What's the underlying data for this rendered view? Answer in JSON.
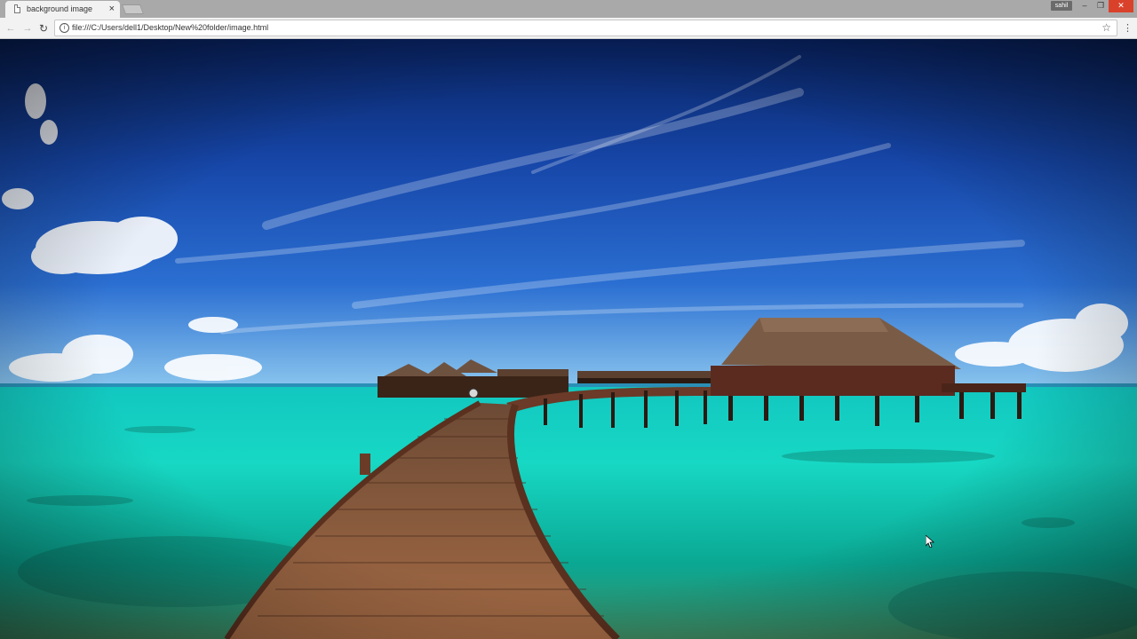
{
  "tab": {
    "title": "background image",
    "close": "×",
    "icon": "document-icon"
  },
  "window": {
    "user_badge": "sahil",
    "minimize": "–",
    "restore": "❐",
    "close": "✕"
  },
  "toolbar": {
    "back": "←",
    "forward": "→",
    "reload": "↻",
    "url": "file:///C:/Users/dell1/Desktop/New%20folder/image.html",
    "info": "i",
    "bookmark": "☆",
    "menu": "⋮"
  },
  "colors": {
    "sky_top": "#0b2a6e",
    "sky_mid": "#1f5ec9",
    "horizon": "#8cc7ee",
    "water_near": "#0fb8a8",
    "water_far": "#18e0cf",
    "dock": "#8a5a3c",
    "hut_roof": "#7a5c46"
  }
}
